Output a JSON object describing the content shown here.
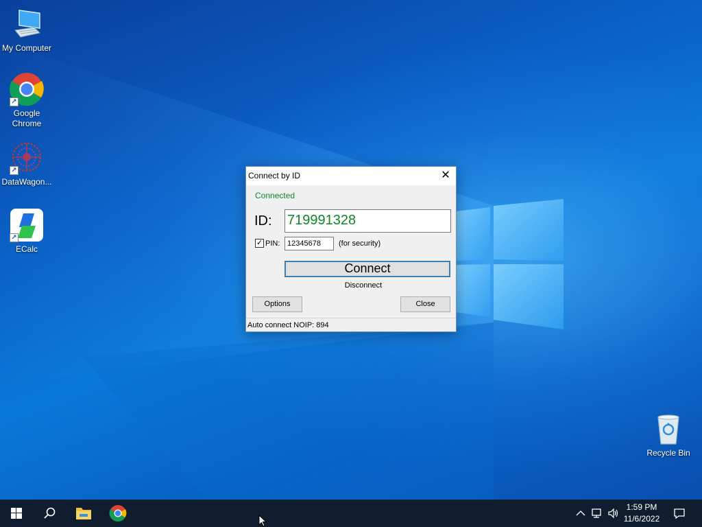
{
  "desktop": {
    "icons": [
      {
        "label": "My Computer",
        "icon": "computer-icon"
      },
      {
        "label": "Google Chrome",
        "icon": "chrome-icon"
      },
      {
        "label": "DataWagon...",
        "icon": "datawagon-icon"
      },
      {
        "label": "ECalc",
        "icon": "ecalc-icon"
      },
      {
        "label": "Recycle Bin",
        "icon": "recycle-bin-icon"
      }
    ]
  },
  "dialog": {
    "title": "Connect by ID",
    "close_glyph": "✕",
    "status": "Connected",
    "id_label": "ID:",
    "id_value": "719991328",
    "pin_checked": true,
    "pin_label": "PIN:",
    "pin_value": "12345678",
    "pin_hint": "(for security)",
    "connect_label": "Connect",
    "disconnect_label": "Disconnect",
    "options_label": "Options",
    "close_label": "Close",
    "status_bar": "Auto connect NOIP: 894"
  },
  "taskbar": {
    "time": "1:59 PM",
    "date": "11/6/2022",
    "pinned": [
      "start-icon",
      "search-icon",
      "file-explorer-icon",
      "chrome-icon"
    ],
    "tray": [
      "chevron-up-icon",
      "network-icon",
      "volume-icon",
      "notification-icon"
    ]
  },
  "colors": {
    "status_green": "#0e8a24",
    "taskbar_bg": "#101d2e",
    "button_focus": "#3c7fb1"
  }
}
